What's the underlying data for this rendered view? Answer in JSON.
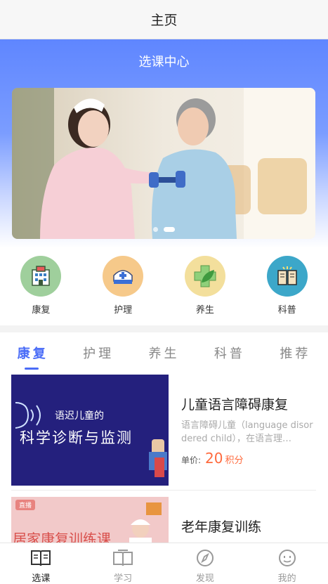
{
  "header": {
    "title": "主页"
  },
  "hero": {
    "title": "选课中心"
  },
  "banner": {
    "slides": 2,
    "active_slide": 2
  },
  "categories": [
    {
      "label": "康复",
      "icon": "hospital-icon",
      "color": "#9fcf9c"
    },
    {
      "label": "护理",
      "icon": "nurse-cap-icon",
      "color": "#f6c98a"
    },
    {
      "label": "养生",
      "icon": "leaf-cross-icon",
      "color": "#f3df9c"
    },
    {
      "label": "科普",
      "icon": "book-icon",
      "color": "#3ca7c9"
    }
  ],
  "tabs": [
    {
      "label": "康复",
      "active": true
    },
    {
      "label": "护理"
    },
    {
      "label": "养生"
    },
    {
      "label": "科普"
    },
    {
      "label": "推荐"
    }
  ],
  "courses": [
    {
      "title": "儿童语言障碍康复",
      "desc": "语言障碍儿童（language disordered child），在语言理…",
      "price_label": "单价:",
      "price": "20",
      "price_unit": "积分",
      "thumb": {
        "line1": "语迟儿童的",
        "line2": "科学诊断与监测",
        "bg": "#24207d"
      }
    },
    {
      "title": "老年康复训练",
      "desc": "",
      "thumb": {
        "line1": "居家康复训练课",
        "badge": "直播",
        "bg": "#f2c9c9"
      }
    }
  ],
  "bottom_nav": [
    {
      "label": "选课",
      "icon": "select-course-icon",
      "active": true
    },
    {
      "label": "学习",
      "icon": "study-book-icon"
    },
    {
      "label": "发现",
      "icon": "discover-compass-icon"
    },
    {
      "label": "我的",
      "icon": "profile-face-icon"
    }
  ],
  "colors": {
    "accent": "#4a6cf7",
    "price": "#ff6a3d",
    "hero": "#5f86ff"
  }
}
